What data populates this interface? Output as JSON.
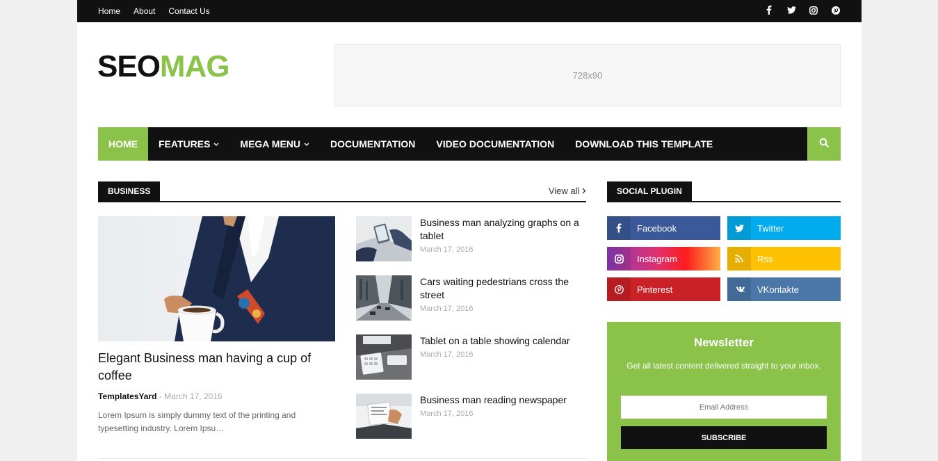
{
  "topbar": {
    "links": [
      "Home",
      "About",
      "Contact Us"
    ],
    "social_icons": [
      "facebook-icon",
      "twitter-icon",
      "instagram-icon",
      "pinterest-icon"
    ]
  },
  "logo": {
    "part1": "SEO",
    "part2": "MAG"
  },
  "ad": {
    "label": "728x90"
  },
  "nav": {
    "items": [
      "HOME",
      "FEATURES",
      "MEGA MENU",
      "DOCUMENTATION",
      "VIDEO DOCUMENTATION",
      "DOWNLOAD THIS TEMPLATE"
    ],
    "accent": "#8bc34a"
  },
  "business": {
    "tag": "BUSINESS",
    "view_all": "View all",
    "featured": {
      "title": "Elegant Business man having a cup of coffee",
      "author": "TemplatesYard",
      "separator": "-",
      "date": "March 17, 2016",
      "excerpt": "Lorem Ipsum is simply dummy text of the printing and typesetting industry. Lorem Ipsu…"
    },
    "list": [
      {
        "title": "Business man analyzing graphs on a tablet",
        "date": "March 17, 2016"
      },
      {
        "title": "Cars waiting pedestrians cross the street",
        "date": "March 17, 2016"
      },
      {
        "title": "Tablet on a table showing calendar",
        "date": "March 17, 2016"
      },
      {
        "title": "Business man reading newspaper",
        "date": "March 17, 2016"
      }
    ]
  },
  "sidebar": {
    "social_tag": "SOCIAL PLUGIN",
    "social": [
      {
        "name": "Facebook",
        "color": "#3b5998",
        "icon": "facebook-icon"
      },
      {
        "name": "Twitter",
        "color": "#00acee",
        "icon": "twitter-icon"
      },
      {
        "name": "Instagram",
        "color": "#dd2a7b",
        "icon": "instagram-icon"
      },
      {
        "name": "Rss",
        "color": "#ffc200",
        "icon": "rss-icon"
      },
      {
        "name": "Pinterest",
        "color": "#ca2127",
        "icon": "pinterest-icon"
      },
      {
        "name": "VKontakte",
        "color": "#4a76a8",
        "icon": "vk-icon"
      }
    ],
    "newsletter": {
      "title": "Newsletter",
      "desc": "Get all latest content delivered straight to your inbox.",
      "placeholder": "Email Address",
      "button": "SUBSCRIBE"
    }
  }
}
